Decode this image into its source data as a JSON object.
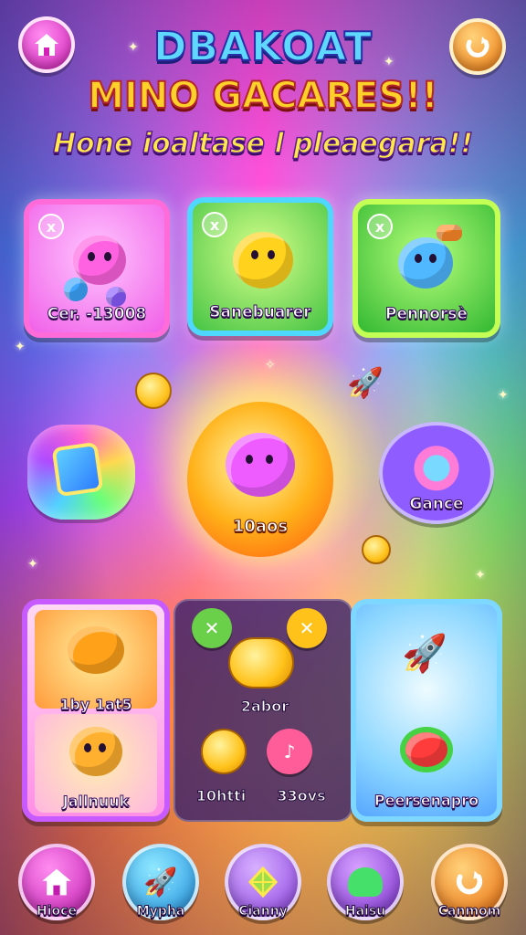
{
  "header": {
    "title_line1": "DBAKOAT",
    "title_line2": "MINO GACARES!!",
    "subtitle": "Hone ioaltase l pleaegara!!"
  },
  "cards": [
    {
      "label": "Cer. -13008",
      "badge": "x"
    },
    {
      "label": "Sanebuarer",
      "badge": "x"
    },
    {
      "label": "Pennorsè",
      "badge": "x"
    }
  ],
  "center": {
    "orb_label": "10aos",
    "ring_label": "Gance"
  },
  "bottom_left": {
    "slot_a_label": "1by 1at5",
    "slot_b_label": "Jallnuuk"
  },
  "bottom_mid": {
    "label_top": "2abor",
    "label_left": "10htti",
    "label_right": "33ovs"
  },
  "bottom_right": {
    "label": "Peersenapro"
  },
  "nav": [
    {
      "label": "Hioce",
      "icon": "house-icon"
    },
    {
      "label": "Mypha",
      "icon": "rocket-icon"
    },
    {
      "label": "Cianny",
      "icon": "kite-icon"
    },
    {
      "label": "Haisu",
      "icon": "slime-icon"
    },
    {
      "label": "Canmom",
      "icon": "refresh-icon"
    }
  ],
  "colors": {
    "accent_pink": "#ff6bd9",
    "accent_orange": "#f07a10",
    "title_blue": "#5fd8ff",
    "title_gold": "#ffcf2a"
  }
}
